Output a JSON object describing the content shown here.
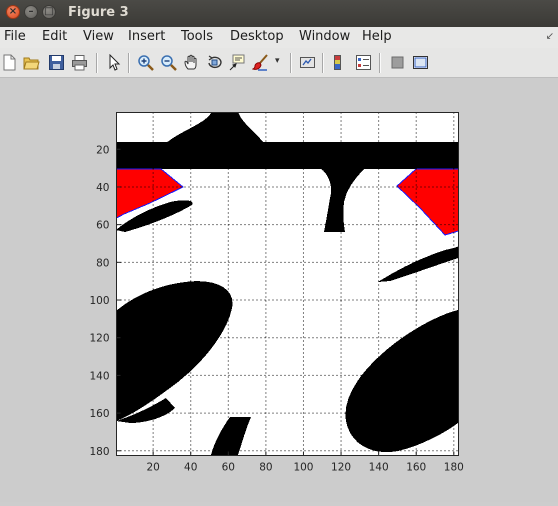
{
  "window": {
    "title": "Figure 3"
  },
  "menu": [
    "File",
    "Edit",
    "View",
    "Insert",
    "Tools",
    "Desktop",
    "Window",
    "Help"
  ],
  "toolbar": {
    "icons": [
      "new-figure-icon",
      "open-file-icon",
      "save-icon",
      "print-icon",
      "edit-plot-icon",
      "zoom-in-icon",
      "zoom-out-icon",
      "pan-icon",
      "rotate-3d-icon",
      "data-cursor-icon",
      "brush-icon",
      "brush-dropdown-icon",
      "link-plot-icon",
      "insert-colorbar-icon",
      "insert-legend-icon",
      "hide-plot-tools-icon",
      "show-plot-tools-icon"
    ]
  },
  "axes": {
    "x_ticks": [
      "20",
      "40",
      "60",
      "80",
      "100",
      "120",
      "140",
      "160",
      "180"
    ],
    "y_ticks": [
      "20",
      "40",
      "60",
      "80",
      "100",
      "120",
      "140",
      "160",
      "180"
    ],
    "xlim": [
      0.5,
      182.5
    ],
    "ylim": [
      0.5,
      182.5
    ],
    "grid": "on",
    "colors": {
      "background": "#ffffff",
      "shape": "#000000",
      "highlight": "#ff0000",
      "highlight_edge": "#1a1aff"
    }
  }
}
